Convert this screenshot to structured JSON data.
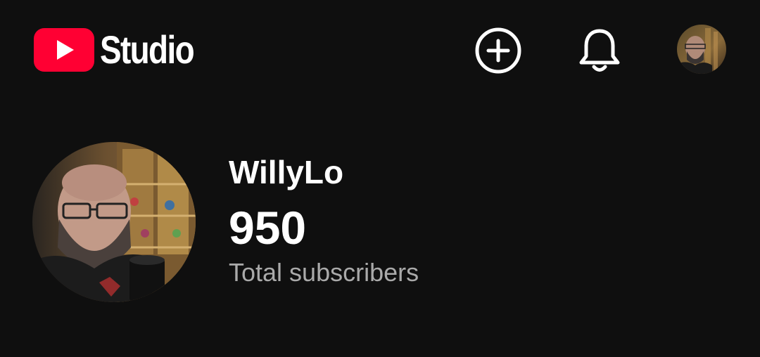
{
  "header": {
    "logo_text": "Studio",
    "brand_color": "#ff0000",
    "icons": {
      "create": "add-circle-icon",
      "notifications": "bell-icon",
      "account": "account-avatar"
    }
  },
  "channel": {
    "name": "WillyLo",
    "subscriber_count": "950",
    "subscriber_label": "Total subscribers"
  }
}
